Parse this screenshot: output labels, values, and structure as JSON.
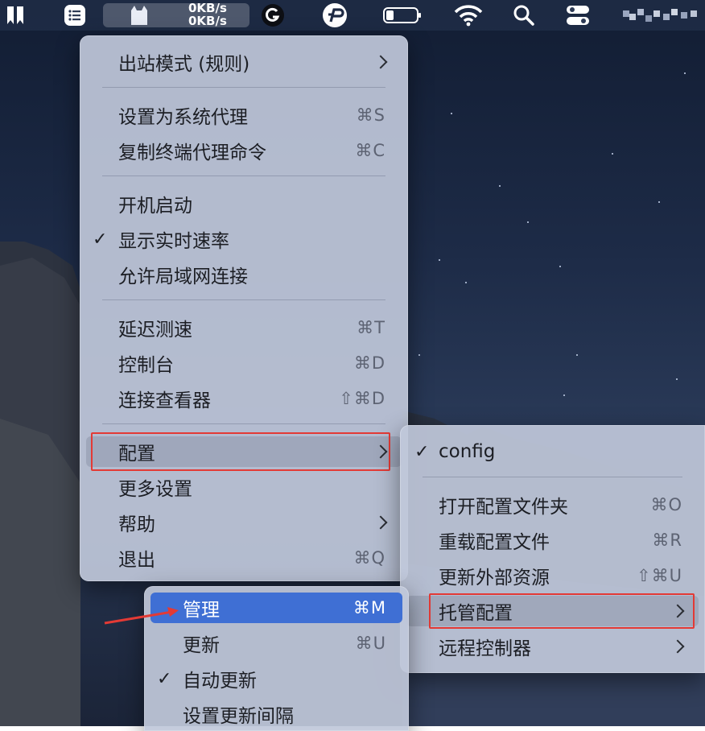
{
  "menubar": {
    "speed_up": "0KB/s",
    "speed_down": "0KB/s"
  },
  "main_menu": {
    "items": [
      {
        "label": "出站模式 (规则)",
        "submenu": true
      },
      {
        "label": "设置为系统代理",
        "shortcut": "⌘S"
      },
      {
        "label": "复制终端代理命令",
        "shortcut": "⌘C"
      },
      {
        "label": "开机启动"
      },
      {
        "label": "显示实时速率",
        "checked": true
      },
      {
        "label": "允许局域网连接"
      },
      {
        "label": "延迟测速",
        "shortcut": "⌘T"
      },
      {
        "label": "控制台",
        "shortcut": "⌘D"
      },
      {
        "label": "连接查看器",
        "shortcut": "⇧⌘D"
      },
      {
        "label": "配置",
        "submenu": true
      },
      {
        "label": "更多设置"
      },
      {
        "label": "帮助",
        "submenu": true
      },
      {
        "label": "退出",
        "shortcut": "⌘Q"
      }
    ]
  },
  "config_menu": {
    "items": [
      {
        "label": "config",
        "checked": true
      },
      {
        "label": "打开配置文件夹",
        "shortcut": "⌘O"
      },
      {
        "label": "重载配置文件",
        "shortcut": "⌘R"
      },
      {
        "label": "更新外部资源",
        "shortcut": "⇧⌘U"
      },
      {
        "label": "托管配置",
        "submenu": true
      },
      {
        "label": "远程控制器",
        "submenu": true
      }
    ]
  },
  "managed_menu": {
    "items": [
      {
        "label": "管理",
        "shortcut": "⌘M"
      },
      {
        "label": "更新",
        "shortcut": "⌘U"
      },
      {
        "label": "自动更新",
        "checked": true
      },
      {
        "label": "设置更新间隔"
      }
    ]
  },
  "check_mark": "✓",
  "colors": {
    "highlight": "#3f6fd4",
    "annotation": "#e33a35"
  }
}
